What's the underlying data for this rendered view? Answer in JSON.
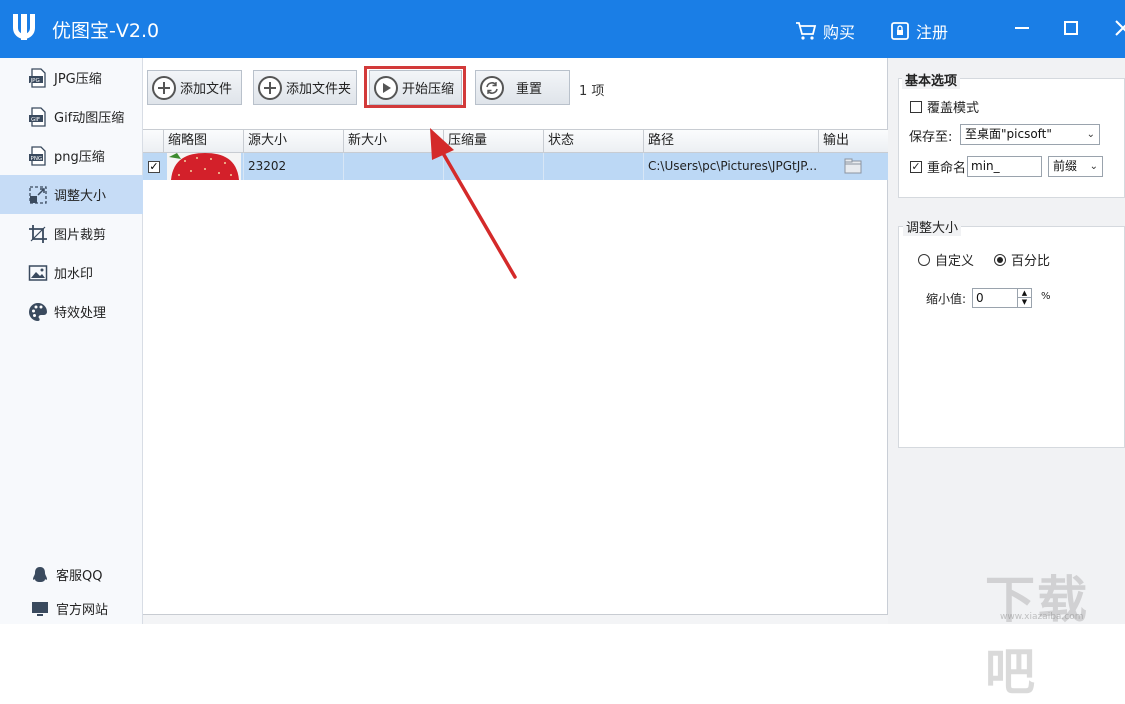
{
  "titlebar": {
    "title": "优图宝-V2.0",
    "buy_label": "购买",
    "register_label": "注册",
    "color": "#1a7ee6"
  },
  "sidebar": {
    "items": [
      {
        "label": "JPG压缩",
        "icon": "jpg-file-icon"
      },
      {
        "label": "Gif动图压缩",
        "icon": "gif-file-icon"
      },
      {
        "label": "png压缩",
        "icon": "png-file-icon"
      },
      {
        "label": "调整大小",
        "icon": "resize-icon",
        "active": true
      },
      {
        "label": "图片裁剪",
        "icon": "crop-icon"
      },
      {
        "label": "加水印",
        "icon": "watermark-image-icon"
      },
      {
        "label": "特效处理",
        "icon": "palette-icon"
      }
    ],
    "bottom": [
      {
        "label": "客服QQ",
        "icon": "qq-penguin-icon"
      },
      {
        "label": "官方网站",
        "icon": "monitor-icon"
      }
    ]
  },
  "toolbar": {
    "add_file": "添加文件",
    "add_folder": "添加文件夹",
    "start": "开始压缩",
    "reset": "重置",
    "count": "1 项"
  },
  "table": {
    "columns": [
      "缩略图",
      "源大小",
      "新大小",
      "压缩量",
      "状态",
      "路径",
      "输出"
    ],
    "rows": [
      {
        "checked": true,
        "source_size": "23202",
        "new_size": "",
        "reduction": "",
        "status": "",
        "path": "C:\\Users\\pc\\Pictures\\JPGtJP..."
      }
    ]
  },
  "basic_options": {
    "title": "基本选项",
    "overwrite_label": "覆盖模式",
    "overwrite_checked": false,
    "save_to_label": "保存至:",
    "save_to_value": "至桌面\"picsoft\"",
    "rename_label": "重命名",
    "rename_checked": true,
    "rename_value": "min_",
    "affix_value": "前缀"
  },
  "resize": {
    "title": "调整大小",
    "custom_label": "自定义",
    "percent_label": "百分比",
    "selected": "百分比",
    "shrink_label": "缩小值:",
    "shrink_value": "0",
    "unit": "%"
  },
  "watermark": {
    "text": "下载吧",
    "site": "www.xiazaiba.com"
  }
}
